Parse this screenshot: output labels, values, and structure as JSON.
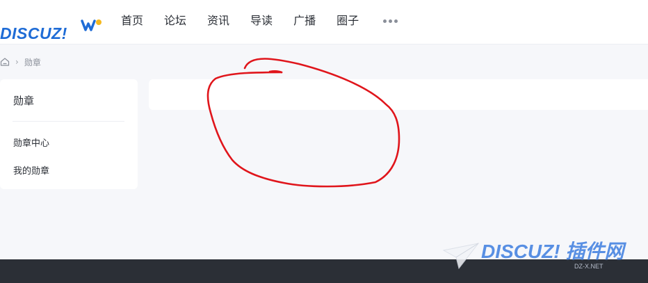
{
  "header": {
    "logo_text": "DISCUZ!",
    "nav": [
      "首页",
      "论坛",
      "资讯",
      "导读",
      "广播",
      "圈子"
    ],
    "more_icon": "more-dots-icon"
  },
  "breadcrumb": {
    "home_icon": "home-icon",
    "separator": "›",
    "current": "勋章"
  },
  "sidebar": {
    "title": "勋章",
    "items": [
      "勋章中心",
      "我的勋章"
    ]
  },
  "annotation": {
    "color": "#e0151b"
  },
  "watermark": {
    "text": "DISCUZ! 插件网",
    "sub": "DZ-X.NET"
  },
  "colors": {
    "brand": "#1f6cd6",
    "background": "#f6f7fa",
    "footer": "#2b2f36"
  }
}
